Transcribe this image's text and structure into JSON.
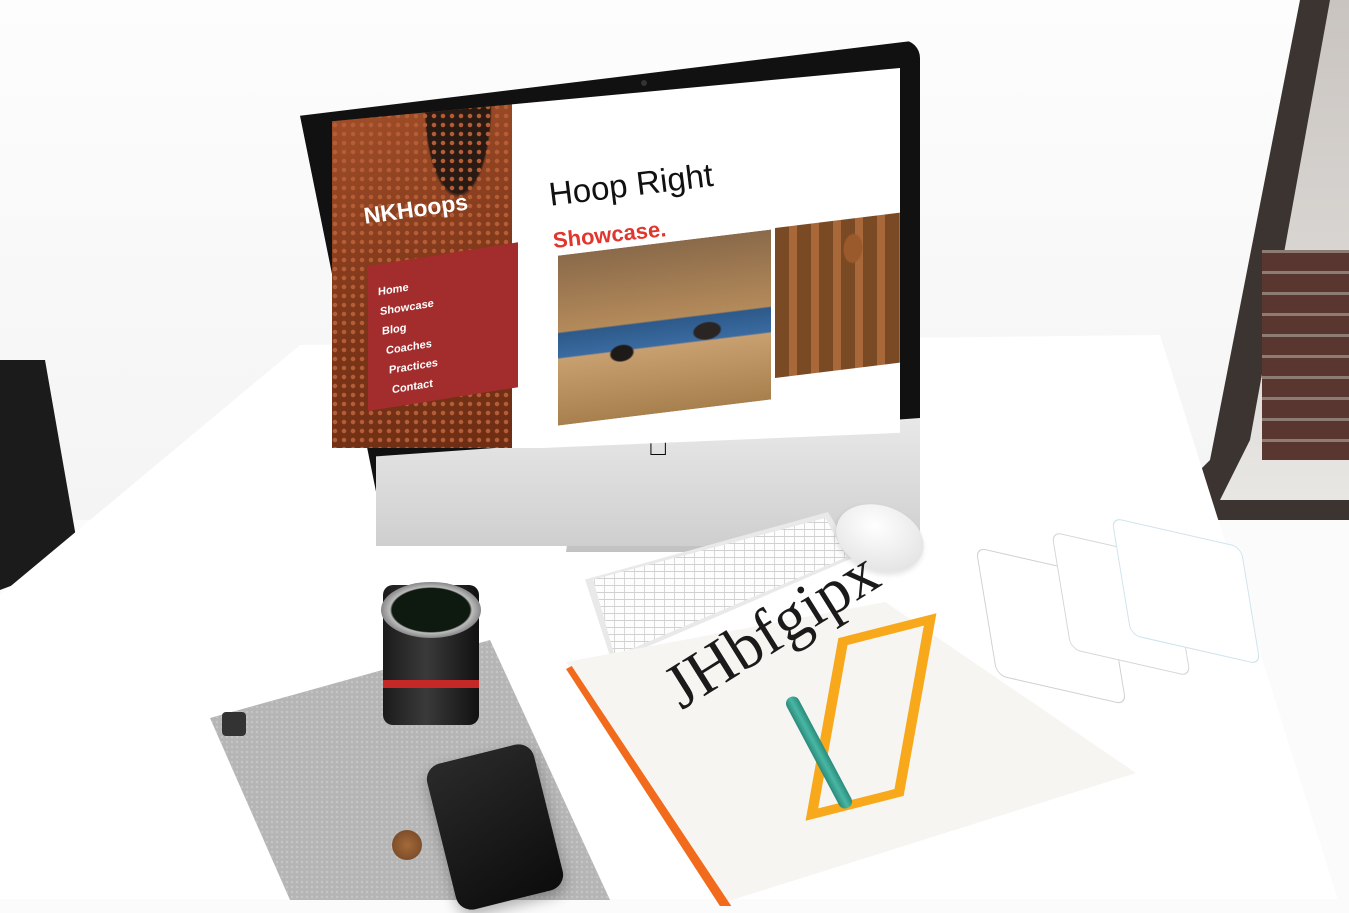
{
  "screen": {
    "brand": "NKHoops",
    "nav_items": [
      "Home",
      "Showcase",
      "Blog",
      "Coaches",
      "Practices",
      "Contact"
    ],
    "hero_title": "Hoop Right",
    "hero_subtitle": "Showcase."
  },
  "book": {
    "type_sample": "JHbfgipx"
  },
  "colors": {
    "accent_red": "#e0362e",
    "nav_red": "#a32c2c",
    "book_orange": "#f26a1b",
    "ruler_yellow": "#f7a81b"
  }
}
